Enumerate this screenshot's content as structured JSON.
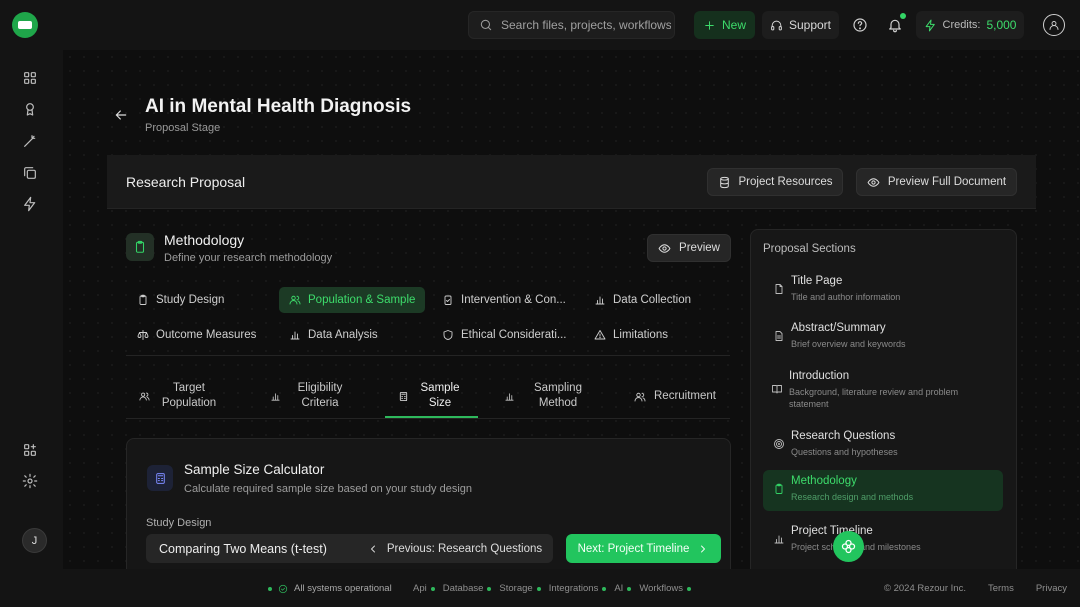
{
  "topbar": {
    "search_placeholder": "Search files, projects, workflows...",
    "new_label": "New",
    "support_label": "Support",
    "credits_label": "Credits:",
    "credits_value": "5,000"
  },
  "sidebar": {
    "items": [
      "grid-icon",
      "award-icon",
      "wand-icon",
      "copy-icon",
      "zap-icon"
    ],
    "bottom_items": [
      "apps-icon",
      "settings-icon"
    ],
    "user_initial": "J"
  },
  "page": {
    "title": "AI in Mental Health Diagnosis",
    "subtitle": "Proposal Stage"
  },
  "proposal_bar": {
    "title": "Research Proposal",
    "resources_label": "Project Resources",
    "preview_doc_label": "Preview Full Document"
  },
  "methodology": {
    "title": "Methodology",
    "subtitle": "Define your research methodology",
    "preview_label": "Preview",
    "tabs": [
      {
        "label": "Study Design",
        "icon": "clipboard-icon"
      },
      {
        "label": "Population & Sample",
        "icon": "users-icon",
        "active": true
      },
      {
        "label": "Intervention & Con...",
        "icon": "clipboard-check-icon"
      },
      {
        "label": "Data Collection",
        "icon": "bar-chart-icon"
      },
      {
        "label": "Outcome Measures",
        "icon": "scale-icon"
      },
      {
        "label": "Data Analysis",
        "icon": "bar-chart-icon"
      },
      {
        "label": "Ethical Considerati...",
        "icon": "shield-icon"
      },
      {
        "label": "Limitations",
        "icon": "warning-icon"
      }
    ],
    "subtabs": [
      {
        "line1": "Target",
        "line2": "Population",
        "icon": "users-icon"
      },
      {
        "line1": "Eligibility",
        "line2": "Criteria",
        "icon": "bar-chart-icon"
      },
      {
        "line1": "Sample",
        "line2": "Size",
        "icon": "calculator-icon",
        "active": true
      },
      {
        "line1": "Sampling",
        "line2": "Method",
        "icon": "bar-chart-icon"
      },
      {
        "line1": "Recruitment",
        "line2": "",
        "icon": "users-icon"
      }
    ]
  },
  "calculator": {
    "title": "Sample Size Calculator",
    "subtitle": "Calculate required sample size based on your study design",
    "study_design_label": "Study Design",
    "study_design_value": "Comparing Two Means (t-test)",
    "prev_label": "Previous: Research Questions",
    "next_label": "Next: Project Timeline"
  },
  "sections": {
    "title": "Proposal Sections",
    "items": [
      {
        "title": "Title Page",
        "sub": "Title and author information",
        "icon": "file-icon"
      },
      {
        "title": "Abstract/Summary",
        "sub": "Brief overview and keywords",
        "icon": "file-text-icon"
      },
      {
        "title": "Introduction",
        "sub": "Background, literature review and problem statement",
        "icon": "book-icon"
      },
      {
        "title": "Research Questions",
        "sub": "Questions and hypotheses",
        "icon": "target-icon"
      },
      {
        "title": "Methodology",
        "sub": "Research design and methods",
        "icon": "clipboard-icon",
        "active": true
      },
      {
        "title": "Project Timeline",
        "sub": "Project schedule and milestones",
        "icon": "bar-chart-icon"
      }
    ]
  },
  "footer": {
    "status": "All systems operational",
    "links": [
      "Api",
      "Database",
      "Storage",
      "Integrations",
      "AI",
      "Workflows"
    ],
    "copyright": "© 2024 Rezour Inc.",
    "terms": "Terms",
    "privacy": "Privacy"
  },
  "colors": {
    "accent": "#22c55e",
    "background": "#0e0e0e",
    "panel": "#171717"
  }
}
